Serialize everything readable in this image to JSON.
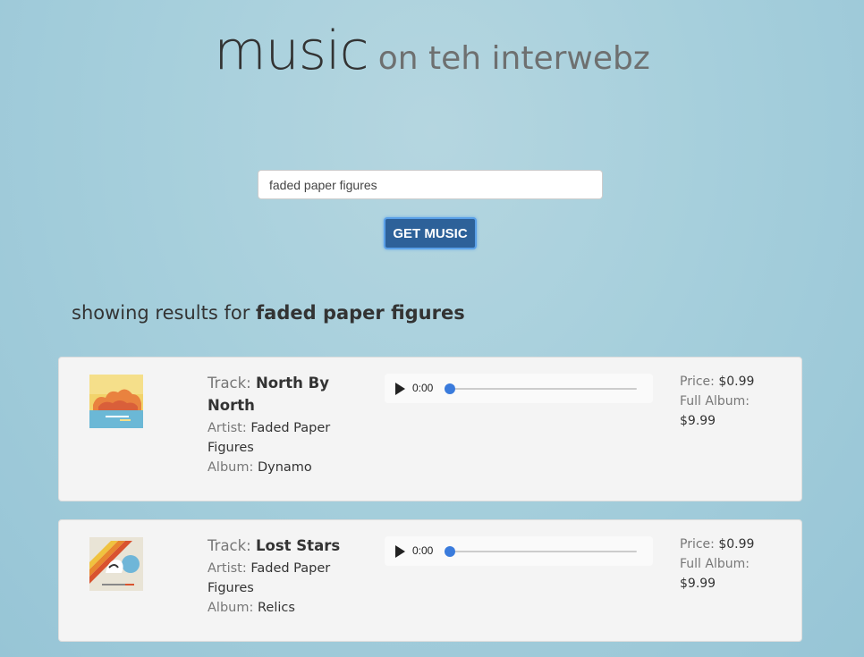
{
  "header": {
    "title": "music",
    "subtitle": "on teh interwebz"
  },
  "search": {
    "value": "faded paper figures",
    "button_label": "GET MUSIC"
  },
  "results": {
    "prefix": "showing results for",
    "query": "faded paper figures",
    "items": [
      {
        "track_label": "Track:",
        "track": "North By North",
        "artist_label": "Artist:",
        "artist": "Faded Paper Figures",
        "album_label": "Album:",
        "album": "Dynamo",
        "time": "0:00",
        "price_label": "Price:",
        "price": "$0.99",
        "full_album_label": "Full Album:",
        "full_album_price": "$9.99",
        "art_icon": "album-art-dynamo"
      },
      {
        "track_label": "Track:",
        "track": "Lost Stars",
        "artist_label": "Artist:",
        "artist": "Faded Paper Figures",
        "album_label": "Album:",
        "album": "Relics",
        "time": "0:00",
        "price_label": "Price:",
        "price": "$0.99",
        "full_album_label": "Full Album:",
        "full_album_price": "$9.99",
        "art_icon": "album-art-relics"
      }
    ]
  },
  "colors": {
    "button": "#2d6199",
    "progress_knob": "#3a7bdc"
  }
}
